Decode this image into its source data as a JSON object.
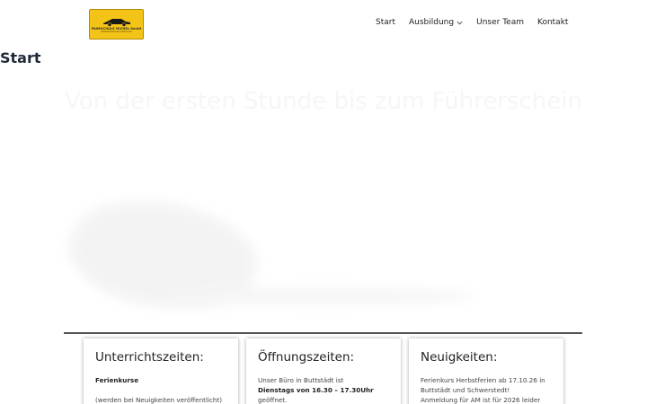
{
  "header": {
    "logo": {
      "name": "FAHRSCHULE MICHEL GmbH",
      "tagline": "www.fahrschule-michel.de",
      "icon": "car-icon"
    },
    "nav": [
      {
        "label": "Start"
      },
      {
        "label": "Ausbildung",
        "icon": "chevron-down-icon"
      },
      {
        "label": "Unser Team"
      },
      {
        "label": "Kontakt"
      }
    ]
  },
  "page": {
    "title": "Start"
  },
  "hero": {
    "heading": "Von der ersten Stunde bis zum Führerschein"
  },
  "cards": {
    "unterricht": {
      "title": "Unterrichtszeiten:",
      "line1": "Ferienkurse",
      "line2": "(werden bei Neuigkeiten veröffentlicht)"
    },
    "oeffnung": {
      "title": "Öffnungszeiten:",
      "line1": "Unser Büro in Buttstädt ist",
      "line2": "Dienstags von 16.30 – 17.30Uhr",
      "line3": "geöffnet."
    },
    "news": {
      "title": "Neuigkeiten:",
      "line1": "Ferienkurs Herbstferien ab 17.10.26 in",
      "line2": "Buttstädt und   Schwerstedt!",
      "line3": "Anmeldung für AM ist für 2026 leider"
    }
  },
  "colors": {
    "logo_bg": "#f3c417",
    "text": "#1f2937",
    "divider": "#555555"
  }
}
